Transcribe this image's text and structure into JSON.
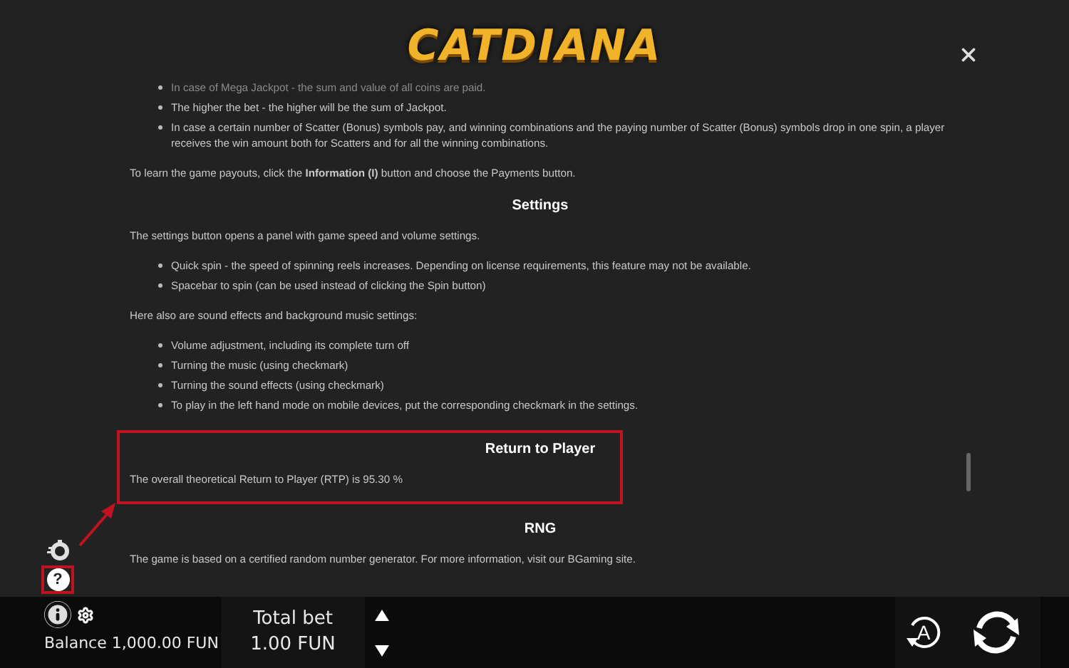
{
  "logo": "CATDIANA",
  "sections": [
    {
      "highlighted": false,
      "blocks": [
        {
          "kind": "bullets",
          "items": [
            {
              "text": "In case of Mega Jackpot - the sum and value of all coins are paid.",
              "faded": true
            },
            {
              "text": "The higher the bet - the higher will be the sum of Jackpot.",
              "faded": false
            },
            {
              "text": "In case a certain number of Scatter (Bonus) symbols pay, and winning combinations and the paying number of Scatter (Bonus) symbols drop in one spin, a player receives the win amount both for Scatters and for all the winning combinations.",
              "faded": false
            }
          ]
        },
        {
          "kind": "paragraph",
          "text": "To learn the game payouts, click the **Information (I)** button and choose the Payments button."
        }
      ]
    },
    {
      "heading": "Settings",
      "highlighted": false,
      "blocks": [
        {
          "kind": "paragraph",
          "text": "The settings button opens a panel with game speed and volume settings."
        },
        {
          "kind": "bullets",
          "items": [
            {
              "text": "Quick spin - the speed of spinning reels increases. Depending on license requirements, this feature may not be available.",
              "faded": false
            },
            {
              "text": "Spacebar to spin (can be used instead of clicking the Spin button)",
              "faded": false
            }
          ]
        },
        {
          "kind": "paragraph",
          "text": "Here also are sound effects and background music settings:"
        },
        {
          "kind": "bullets",
          "items": [
            {
              "text": "Volume adjustment, including its complete turn off",
              "faded": false
            },
            {
              "text": "Turning the music (using checkmark)",
              "faded": false
            },
            {
              "text": "Turning the sound effects (using checkmark)",
              "faded": false
            },
            {
              "text": "To play in the left hand mode on mobile devices, put the corresponding checkmark in the settings.",
              "faded": false
            }
          ]
        }
      ]
    },
    {
      "heading": "Return to Player",
      "highlighted": true,
      "blocks": [
        {
          "kind": "paragraph",
          "text": "The overall theoretical Return to Player (RTP) is 95.30 %"
        }
      ]
    },
    {
      "heading": "RNG",
      "highlighted": false,
      "blocks": [
        {
          "kind": "paragraph",
          "text": "The game is based on a certified random number generator. For more information, visit our BGaming site."
        }
      ]
    }
  ],
  "side_buttons": [
    {
      "kind": "history",
      "highlighted": false
    },
    {
      "kind": "help",
      "highlighted": true,
      "label": "?"
    }
  ],
  "balance": "Balance 1,000.00 FUN",
  "total_bet": {
    "label": "Total bet",
    "value": "1.00 FUN"
  },
  "autoplay_label": "A"
}
